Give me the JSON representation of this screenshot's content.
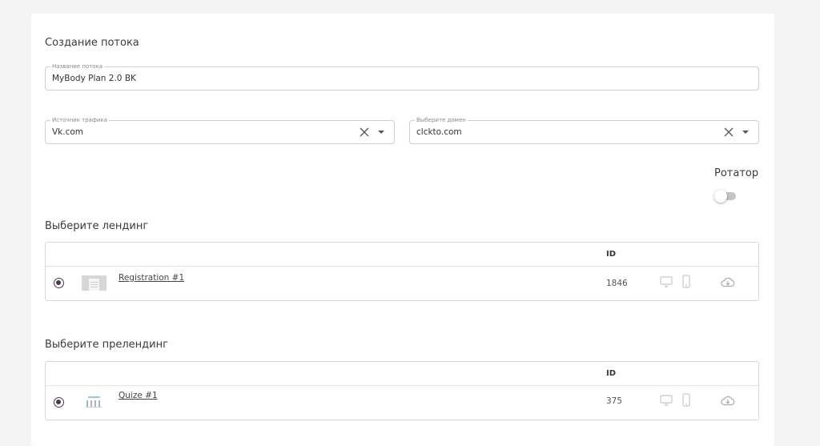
{
  "form": {
    "title": "Создание потока",
    "flow_name": {
      "label": "Название потока",
      "value": "MyBody Plan 2.0 BK"
    },
    "traffic_source": {
      "label": "Источник трафика",
      "value": "Vk.com"
    },
    "domain": {
      "label": "Выберите домен",
      "value": "clckto.com"
    },
    "rotator": {
      "label": "Ротатор",
      "enabled": false
    }
  },
  "landing": {
    "title": "Выберите лендинг",
    "id_header": "ID",
    "rows": [
      {
        "name": "Registration #1",
        "id": "1846",
        "selected": true
      }
    ]
  },
  "prelanding": {
    "title": "Выберите прелендинг",
    "id_header": "ID",
    "rows": [
      {
        "name": "Quize #1",
        "id": "375",
        "selected": true
      }
    ]
  },
  "icons": [
    "close-icon",
    "caret-down-icon",
    "desktop-icon",
    "mobile-icon",
    "cloud-download-icon"
  ],
  "colors": {
    "radio_accent": "#4a3b4b",
    "border": "#cfcfcf",
    "icon_gray": "#c8c8c8"
  }
}
